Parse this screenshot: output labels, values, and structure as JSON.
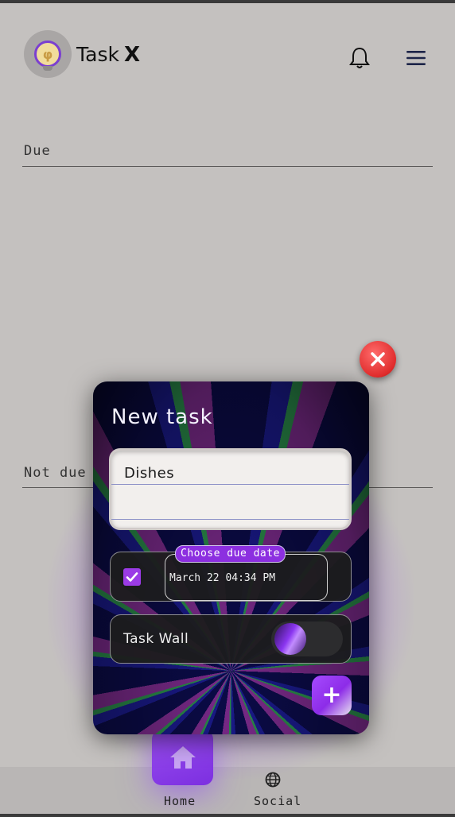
{
  "header": {
    "app_name_part1": "Task",
    "app_name_part2": "X",
    "logo_icon": "lightbulb-icon",
    "notification_icon": "bell-icon",
    "menu_icon": "hamburger-menu-icon"
  },
  "sections": {
    "due_label": "Due",
    "not_due_label": "Not due"
  },
  "modal": {
    "title": "New task",
    "task_name_value": "Dishes",
    "due_date_chip": "Choose due date",
    "due_date_value": "March 22 04:34 PM",
    "due_date_enabled": true,
    "task_wall_label": "Task Wall",
    "task_wall_enabled": true,
    "add_button_label": "+",
    "close_icon": "close-icon"
  },
  "bottom_nav": {
    "items": [
      {
        "label": "Home",
        "icon": "home-icon",
        "active": true
      },
      {
        "label": "Social",
        "icon": "globe-icon",
        "active": false
      }
    ]
  },
  "colors": {
    "background": "#c4c1bf",
    "accent": "#8c2fe0",
    "close": "#e02c2c"
  }
}
